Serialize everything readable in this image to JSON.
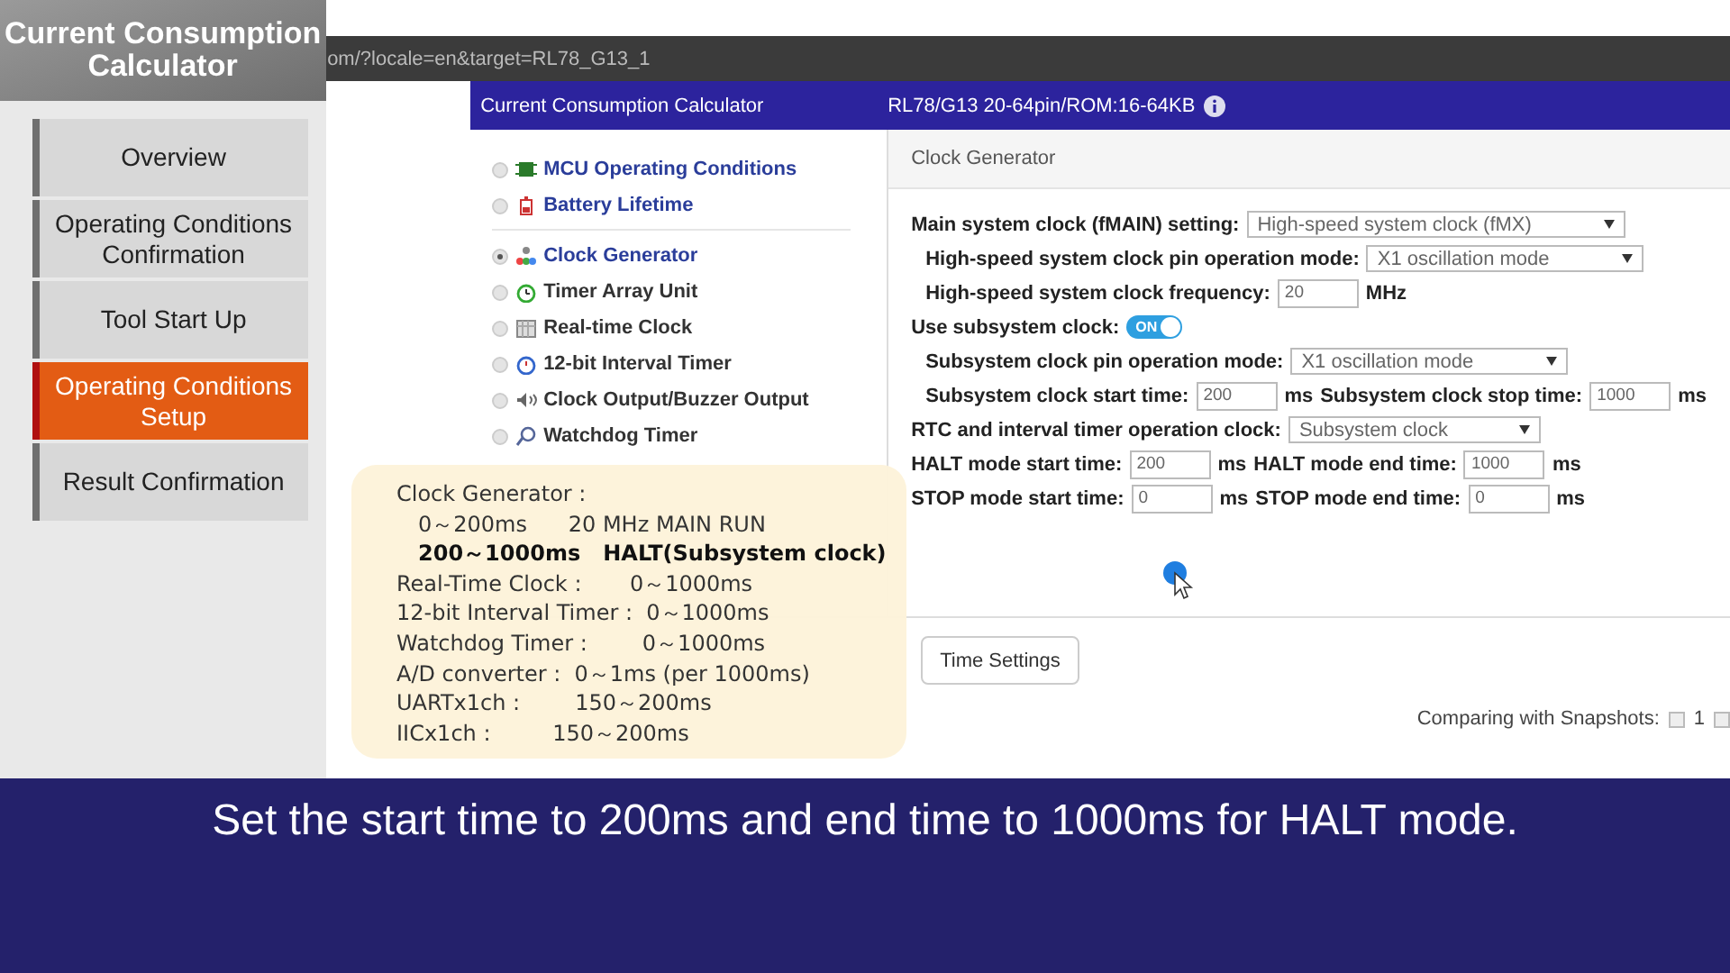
{
  "app_title": "Current Consumption Calculator",
  "steps": [
    {
      "label": "Overview",
      "selected": false
    },
    {
      "label": "Operating Conditions Confirmation",
      "selected": false
    },
    {
      "label": "Tool Start Up",
      "selected": false
    },
    {
      "label": "Operating Conditions Setup",
      "selected": true
    },
    {
      "label": "Result Confirmation",
      "selected": false
    }
  ],
  "browser": {
    "url": "om/?locale=en&target=RL78_G13_1"
  },
  "header": {
    "title": "Current Consumption Calculator",
    "device": "RL78/G13 20-64pin/ROM:16-64KB"
  },
  "nav_groups": [
    [
      {
        "label": "MCU Operating Conditions",
        "selected": false
      },
      {
        "label": "Battery Lifetime",
        "selected": false
      }
    ],
    [
      {
        "label": "Clock Generator",
        "selected": true
      },
      {
        "label": "Timer Array Unit",
        "selected": false
      },
      {
        "label": "Real-time Clock",
        "selected": false
      },
      {
        "label": "12-bit Interval Timer",
        "selected": false
      },
      {
        "label": "Clock Output/Buzzer Output",
        "selected": false
      },
      {
        "label": "Watchdog Timer",
        "selected": false
      }
    ]
  ],
  "panel_title": "Clock Generator",
  "form_rows": [
    {
      "parts": [
        {
          "kind": "label",
          "text": "Main system clock (fMAIN) setting:"
        },
        {
          "kind": "select",
          "value": "High-speed system clock (fMX)"
        }
      ],
      "children": [
        {
          "parts": [
            {
              "kind": "label",
              "text": "High-speed system clock pin operation mode:"
            },
            {
              "kind": "select",
              "value": "X1 oscillation mode"
            }
          ]
        },
        {
          "parts": [
            {
              "kind": "label",
              "text": "High-speed system clock frequency:"
            },
            {
              "kind": "input",
              "value": "20"
            },
            {
              "kind": "label",
              "text": "MHz"
            }
          ]
        }
      ]
    },
    {
      "parts": [
        {
          "kind": "label",
          "text": "Use subsystem clock:"
        },
        {
          "kind": "toggle",
          "text": "ON",
          "on": true
        }
      ],
      "children": [
        {
          "parts": [
            {
              "kind": "label",
              "text": "Subsystem clock pin operation mode:"
            },
            {
              "kind": "select",
              "value": "X1 oscillation mode"
            }
          ]
        },
        {
          "parts": [
            {
              "kind": "label",
              "text": "Subsystem clock start time:"
            },
            {
              "kind": "input",
              "value": "200"
            },
            {
              "kind": "label",
              "text": "ms"
            },
            {
              "kind": "label",
              "text": "Subsystem clock stop time:"
            },
            {
              "kind": "input",
              "value": "1000"
            },
            {
              "kind": "label",
              "text": "ms"
            }
          ]
        }
      ]
    },
    {
      "parts": [
        {
          "kind": "label",
          "text": "RTC and interval timer operation clock:"
        },
        {
          "kind": "select",
          "value": "Subsystem clock"
        }
      ]
    },
    {
      "parts": [
        {
          "kind": "label",
          "text": "HALT mode start time:"
        },
        {
          "kind": "input",
          "value": "200"
        },
        {
          "kind": "label",
          "text": "ms"
        },
        {
          "kind": "label",
          "text": "HALT mode end time:"
        },
        {
          "kind": "input",
          "value": "1000"
        },
        {
          "kind": "label",
          "text": "ms"
        }
      ]
    },
    {
      "parts": [
        {
          "kind": "label",
          "text": "STOP mode start time:"
        },
        {
          "kind": "input",
          "value": "0"
        },
        {
          "kind": "label",
          "text": "ms"
        },
        {
          "kind": "label",
          "text": "STOP mode end time:"
        },
        {
          "kind": "input",
          "value": "0"
        },
        {
          "kind": "label",
          "text": "ms"
        }
      ]
    }
  ],
  "footer": {
    "button": "Time Settings",
    "snapshots_label": "Comparing with Snapshots:",
    "snapshots": [
      {
        "label": "1",
        "checked": false
      },
      {
        "checked": false
      }
    ]
  },
  "note": [
    {
      "text": "Clock Generator :",
      "bold": false,
      "children": [
        {
          "text": "0～200ms      20 MHz MAIN RUN",
          "bold": false
        },
        {
          "text": "200～1000ms   HALT(Subsystem clock)",
          "bold": true
        }
      ]
    },
    {
      "text": "Real-Time Clock :       0～1000ms",
      "bold": false
    },
    {
      "text": "12-bit Interval Timer :  0～1000ms",
      "bold": false
    },
    {
      "text": "Watchdog Timer :        0～1000ms",
      "bold": false
    },
    {
      "text": "A/D converter :  0～1ms (per 1000ms)",
      "bold": false
    },
    {
      "text": "UARTx1ch :        150～200ms",
      "bold": false
    },
    {
      "text": "IICx1ch :         150～200ms",
      "bold": false
    }
  ],
  "caption": "Set the start time to 200ms and end time to 1000ms for HALT mode."
}
